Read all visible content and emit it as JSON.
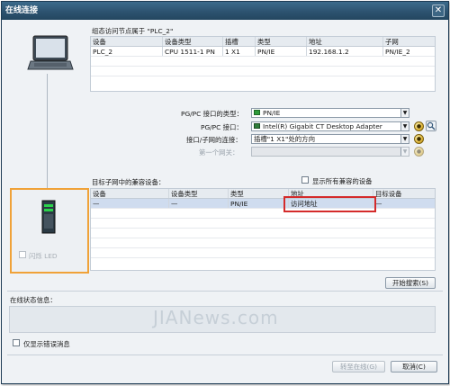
{
  "window": {
    "title": "在线连接",
    "close_glyph": "✕"
  },
  "top_table": {
    "caption": "组态访问节点属于 \"PLC_2\"",
    "headers": [
      "设备",
      "设备类型",
      "插槽",
      "类型",
      "地址",
      "子网"
    ],
    "rows": [
      [
        "PLC_2",
        "CPU 1511-1 PN",
        "1 X1",
        "PN/IE",
        "192.168.1.2",
        "PN/IE_2"
      ]
    ]
  },
  "settings": {
    "pgpc_type_label": "PG/PC 接口的类型：",
    "pgpc_type_value": "PN/IE",
    "pgpc_if_label": "PG/PC 接口：",
    "pgpc_if_value": "Intel(R) Gigabit CT Desktop Adapter",
    "subnet_conn_label": "接口/子网的连接：",
    "subnet_conn_value": "插槽\"1 X1\"处的方向",
    "gateway_label": "第一个网关：",
    "gateway_value": ""
  },
  "target": {
    "caption": "目标子网中的兼容设备：",
    "show_all_label": "显示所有兼容的设备",
    "headers": [
      "设备",
      "设备类型",
      "类型",
      "地址",
      "目标设备"
    ],
    "rows": [
      [
        "—",
        "—",
        "PN/IE",
        "访问地址",
        "—"
      ]
    ]
  },
  "flash_led_label": "闪烁 LED",
  "start_search_label": "开始搜索(S)",
  "status": {
    "caption": "在线状态信息：",
    "errors_only_label": "仅显示错误消息"
  },
  "buttons": {
    "goto_online_label": "转至在线(G)",
    "cancel_label": "取消(C)"
  },
  "watermark": "JIANews.com",
  "colors": {
    "title_bar": "#2d5370",
    "orange_frame": "#f0a238",
    "red_highlight": "#d42b2b",
    "selected_row": "#cfdcef"
  }
}
